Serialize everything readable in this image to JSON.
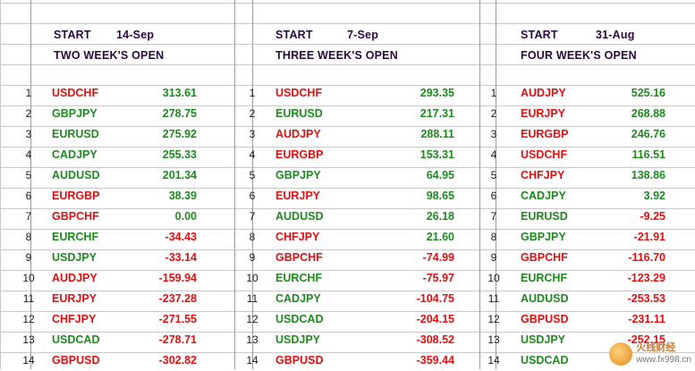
{
  "blocks": [
    {
      "start_label": "START",
      "start_date": "14-Sep",
      "title": "TWO WEEK'S OPEN",
      "rows": [
        {
          "n": "1",
          "pair": "USDCHF",
          "value": "313.61",
          "sign": "neg",
          "vsign": "pos"
        },
        {
          "n": "2",
          "pair": "GBPJPY",
          "value": "278.75",
          "sign": "pos",
          "vsign": "pos"
        },
        {
          "n": "3",
          "pair": "EURUSD",
          "value": "275.92",
          "sign": "pos",
          "vsign": "pos"
        },
        {
          "n": "4",
          "pair": "CADJPY",
          "value": "255.33",
          "sign": "pos",
          "vsign": "pos"
        },
        {
          "n": "5",
          "pair": "AUDUSD",
          "value": "201.34",
          "sign": "pos",
          "vsign": "pos"
        },
        {
          "n": "6",
          "pair": "EURGBP",
          "value": "38.39",
          "sign": "neg",
          "vsign": "pos"
        },
        {
          "n": "7",
          "pair": "GBPCHF",
          "value": "0.00",
          "sign": "neg",
          "vsign": "pos"
        },
        {
          "n": "8",
          "pair": "EURCHF",
          "value": "-34.43",
          "sign": "pos",
          "vsign": "neg"
        },
        {
          "n": "9",
          "pair": "USDJPY",
          "value": "-33.14",
          "sign": "pos",
          "vsign": "neg"
        },
        {
          "n": "10",
          "pair": "AUDJPY",
          "value": "-159.94",
          "sign": "neg",
          "vsign": "neg"
        },
        {
          "n": "11",
          "pair": "EURJPY",
          "value": "-237.28",
          "sign": "neg",
          "vsign": "neg"
        },
        {
          "n": "12",
          "pair": "CHFJPY",
          "value": "-271.55",
          "sign": "neg",
          "vsign": "neg"
        },
        {
          "n": "13",
          "pair": "USDCAD",
          "value": "-278.71",
          "sign": "pos",
          "vsign": "neg"
        },
        {
          "n": "14",
          "pair": "GBPUSD",
          "value": "-302.82",
          "sign": "neg",
          "vsign": "neg"
        }
      ]
    },
    {
      "start_label": "START",
      "start_date": "7-Sep",
      "title": "THREE WEEK'S OPEN",
      "rows": [
        {
          "n": "1",
          "pair": "USDCHF",
          "value": "293.35",
          "sign": "neg",
          "vsign": "pos"
        },
        {
          "n": "2",
          "pair": "EURUSD",
          "value": "217.31",
          "sign": "pos",
          "vsign": "pos"
        },
        {
          "n": "3",
          "pair": "AUDJPY",
          "value": "288.11",
          "sign": "neg",
          "vsign": "pos"
        },
        {
          "n": "4",
          "pair": "EURGBP",
          "value": "153.31",
          "sign": "neg",
          "vsign": "pos"
        },
        {
          "n": "5",
          "pair": "GBPJPY",
          "value": "64.95",
          "sign": "pos",
          "vsign": "pos"
        },
        {
          "n": "6",
          "pair": "EURJPY",
          "value": "98.65",
          "sign": "neg",
          "vsign": "pos"
        },
        {
          "n": "7",
          "pair": "AUDUSD",
          "value": "26.18",
          "sign": "pos",
          "vsign": "pos"
        },
        {
          "n": "8",
          "pair": "CHFJPY",
          "value": "21.60",
          "sign": "neg",
          "vsign": "pos"
        },
        {
          "n": "9",
          "pair": "GBPCHF",
          "value": "-74.99",
          "sign": "neg",
          "vsign": "neg"
        },
        {
          "n": "10",
          "pair": "EURCHF",
          "value": "-75.97",
          "sign": "pos",
          "vsign": "neg"
        },
        {
          "n": "11",
          "pair": "CADJPY",
          "value": "-104.75",
          "sign": "pos",
          "vsign": "neg"
        },
        {
          "n": "12",
          "pair": "USDCAD",
          "value": "-204.15",
          "sign": "pos",
          "vsign": "neg"
        },
        {
          "n": "13",
          "pair": "USDJPY",
          "value": "-308.52",
          "sign": "pos",
          "vsign": "neg"
        },
        {
          "n": "14",
          "pair": "GBPUSD",
          "value": "-359.44",
          "sign": "neg",
          "vsign": "neg"
        }
      ]
    },
    {
      "start_label": "START",
      "start_date": "31-Aug",
      "title": "FOUR WEEK'S OPEN",
      "rows": [
        {
          "n": "1",
          "pair": "AUDJPY",
          "value": "525.16",
          "sign": "neg",
          "vsign": "pos"
        },
        {
          "n": "2",
          "pair": "EURJPY",
          "value": "268.88",
          "sign": "neg",
          "vsign": "pos"
        },
        {
          "n": "3",
          "pair": "EURGBP",
          "value": "246.76",
          "sign": "neg",
          "vsign": "pos"
        },
        {
          "n": "4",
          "pair": "USDCHF",
          "value": "116.51",
          "sign": "neg",
          "vsign": "pos"
        },
        {
          "n": "5",
          "pair": "CHFJPY",
          "value": "138.86",
          "sign": "neg",
          "vsign": "pos"
        },
        {
          "n": "6",
          "pair": "CADJPY",
          "value": "3.92",
          "sign": "pos",
          "vsign": "pos"
        },
        {
          "n": "7",
          "pair": "EURUSD",
          "value": "-9.25",
          "sign": "pos",
          "vsign": "neg"
        },
        {
          "n": "8",
          "pair": "GBPJPY",
          "value": "-21.91",
          "sign": "pos",
          "vsign": "neg"
        },
        {
          "n": "9",
          "pair": "GBPCHF",
          "value": "-116.70",
          "sign": "neg",
          "vsign": "neg"
        },
        {
          "n": "10",
          "pair": "EURCHF",
          "value": "-123.29",
          "sign": "pos",
          "vsign": "neg"
        },
        {
          "n": "11",
          "pair": "AUDUSD",
          "value": "-253.53",
          "sign": "pos",
          "vsign": "neg"
        },
        {
          "n": "12",
          "pair": "GBPUSD",
          "value": "-231.11",
          "sign": "neg",
          "vsign": "neg"
        },
        {
          "n": "13",
          "pair": "USDJPY",
          "value": "-252.15",
          "sign": "pos",
          "vsign": "neg"
        },
        {
          "n": "14",
          "pair": "USDCAD",
          "value": "",
          "sign": "pos",
          "vsign": "neg"
        }
      ]
    }
  ],
  "colors": {
    "positive": "#1e8a1e",
    "negative": "#e01010",
    "header": "#2b0a40",
    "grid": "#c8c8c8"
  },
  "watermark": {
    "brand": "火线财经",
    "url": "www.fx998.cn"
  }
}
